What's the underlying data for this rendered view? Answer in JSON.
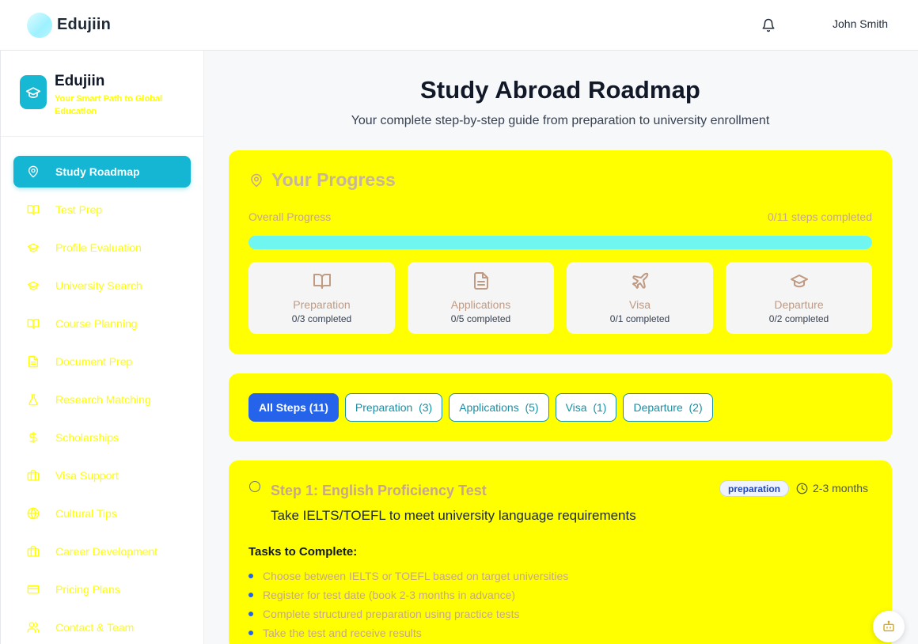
{
  "app": {
    "name": "Edujiin"
  },
  "header": {
    "user_name": "John Smith"
  },
  "sidebar": {
    "title": "Edujiin",
    "tagline": "Your Smart Path to Global Education",
    "items": [
      {
        "label": "Study Roadmap",
        "icon": "map-pin-icon",
        "active": true
      },
      {
        "label": "Test Prep",
        "icon": "book-open-icon"
      },
      {
        "label": "Profile Evaluation",
        "icon": "graduation-cap-icon"
      },
      {
        "label": "University Search",
        "icon": "graduation-cap-icon"
      },
      {
        "label": "Course Planning",
        "icon": "book-open-icon"
      },
      {
        "label": "Document Prep",
        "icon": "file-text-icon"
      },
      {
        "label": "Research Matching",
        "icon": "flask-icon"
      },
      {
        "label": "Scholarships",
        "icon": "dollar-icon"
      },
      {
        "label": "Visa Support",
        "icon": "briefcase-icon"
      },
      {
        "label": "Cultural Tips",
        "icon": "globe-icon"
      },
      {
        "label": "Career Development",
        "icon": "briefcase-icon"
      },
      {
        "label": "Pricing Plans",
        "icon": "credit-card-icon"
      },
      {
        "label": "Contact & Team",
        "icon": "users-icon"
      }
    ]
  },
  "main": {
    "title": "Study Abroad Roadmap",
    "subtitle": "Your complete step-by-step guide from preparation to university enrollment"
  },
  "progress": {
    "title": "Your Progress",
    "overall_label": "Overall Progress",
    "steps_completed_text": "0/11 steps completed",
    "fraction": 0,
    "stages": [
      {
        "name": "Preparation",
        "sub": "0/3 completed",
        "icon": "book-open-icon"
      },
      {
        "name": "Applications",
        "sub": "0/5 completed",
        "icon": "file-text-icon"
      },
      {
        "name": "Visa",
        "sub": "0/1 completed",
        "icon": "plane-icon"
      },
      {
        "name": "Departure",
        "sub": "0/2 completed",
        "icon": "graduation-cap-icon"
      }
    ]
  },
  "filters": [
    {
      "label": "All Steps (11)",
      "active": true
    },
    {
      "label": "Preparation  (3)"
    },
    {
      "label": "Applications  (5)"
    },
    {
      "label": "Visa  (1)"
    },
    {
      "label": "Departure  (2)"
    }
  ],
  "step": {
    "title": "Step 1: English Proficiency Test",
    "badge": "preparation",
    "duration": "2-3 months",
    "description": "Take IELTS/TOEFL to meet university language requirements",
    "tasks_heading": "Tasks to Complete:",
    "tasks": [
      "Choose between IELTS or TOEFL based on target universities",
      "Register for test date (book 2-3 months in advance)",
      "Complete structured preparation using practice tests",
      "Take the test and receive results"
    ]
  },
  "colors": {
    "accent": "#14b6d4",
    "card_bg": "#ffff00",
    "primary_button": "#2563eb"
  }
}
